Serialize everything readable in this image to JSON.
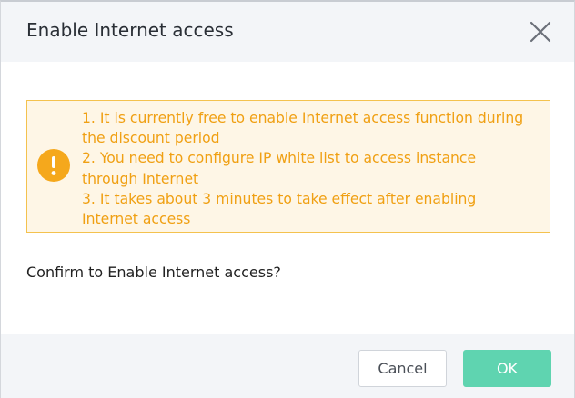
{
  "dialog": {
    "title": "Enable Internet access",
    "close_icon": "close-icon"
  },
  "notice": {
    "icon": "exclamation-circle-icon",
    "color": "#f0a013",
    "background": "#fef6e6",
    "border": "#f4c24e",
    "lines": [
      "1. It is currently free to enable Internet access function during",
      "the discount period",
      "2. You need to configure IP white list to access instance",
      "through Internet",
      "3. It takes about 3 minutes to take effect after enabling",
      "Internet access"
    ]
  },
  "confirm_text": "Confirm to Enable Internet access?",
  "footer": {
    "cancel_label": "Cancel",
    "ok_label": "OK",
    "ok_color": "#5fd4b0"
  }
}
